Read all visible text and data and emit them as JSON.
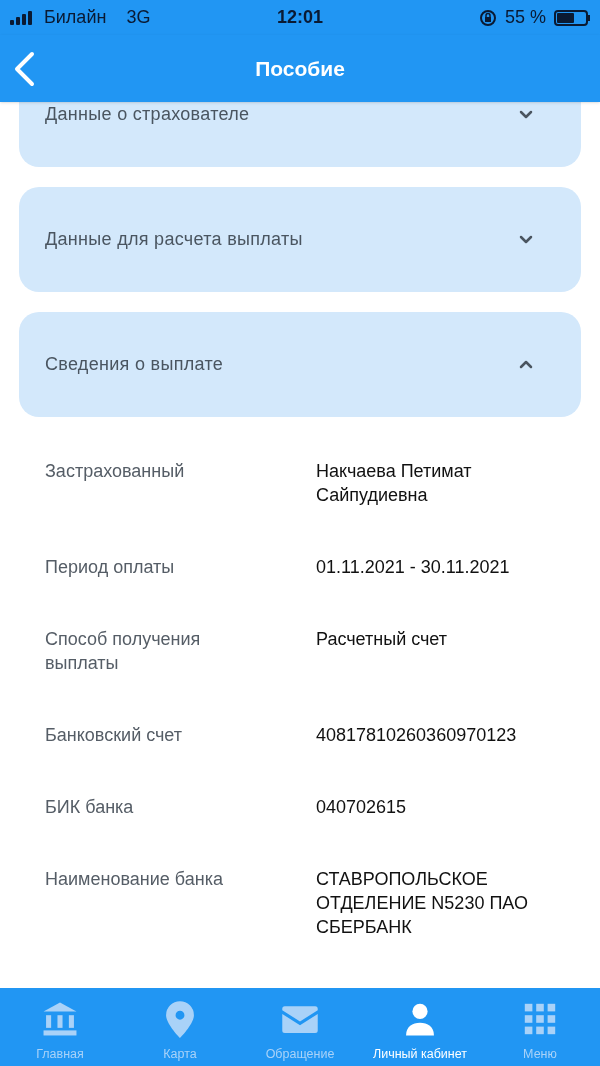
{
  "status_bar": {
    "carrier": "Билайн",
    "network": "3G",
    "time": "12:01",
    "battery": "55 %"
  },
  "header": {
    "title": "Пособие"
  },
  "sections": [
    {
      "title": "Данные о страхователе",
      "expanded": false
    },
    {
      "title": "Данные для расчета выплаты",
      "expanded": false
    },
    {
      "title": "Сведения о выплате",
      "expanded": true
    }
  ],
  "details": [
    {
      "label": "Застрахованный",
      "value": "Накчаева Петимат Сайпудиевна"
    },
    {
      "label": "Период оплаты",
      "value": "01.11.2021 - 30.11.2021"
    },
    {
      "label": "Способ получения выплаты",
      "value": "Расчетный счет"
    },
    {
      "label": "Банковский счет",
      "value": "40817810260360970123"
    },
    {
      "label": "БИК банка",
      "value": "040702615"
    },
    {
      "label": "Наименование банка",
      "value": "СТАВРОПОЛЬСКОЕ ОТДЕЛЕНИЕ N5230 ПАО СБЕРБАНК"
    }
  ],
  "tab_bar": [
    {
      "label": "Главная",
      "kind": "bank",
      "selected": false
    },
    {
      "label": "Карта",
      "kind": "pin",
      "selected": false
    },
    {
      "label": "Обращение",
      "kind": "mail",
      "selected": false
    },
    {
      "label": "Личный кабинет",
      "kind": "person",
      "selected": true
    },
    {
      "label": "Меню",
      "kind": "grid",
      "selected": false
    }
  ]
}
